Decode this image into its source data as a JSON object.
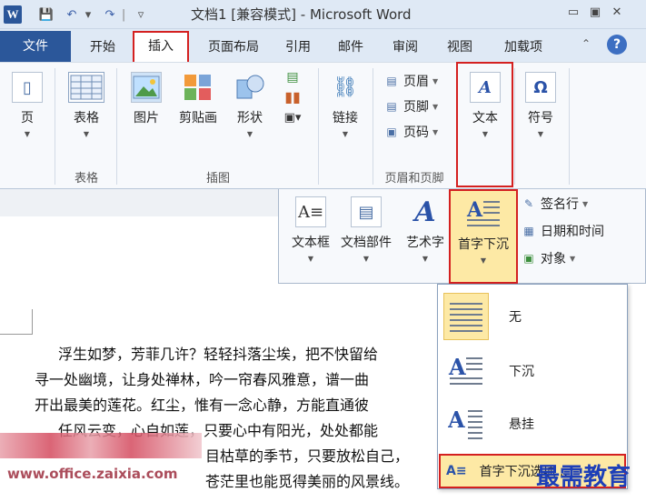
{
  "window": {
    "title": "文档1 [兼容模式] - Microsoft Word",
    "logo_letter": "W",
    "controls": [
      "▭",
      "▣",
      "✕"
    ]
  },
  "quick_access": {
    "save_icon": "💾",
    "undo_icon": "↶",
    "redo_icon": "↷",
    "dropdown": "▾",
    "separator": "|",
    "customize": "▿"
  },
  "tabs": {
    "file": "文件",
    "home": "开始",
    "insert": "插入",
    "layout": "页面布局",
    "references": "引用",
    "mailings": "邮件",
    "review": "审阅",
    "view": "视图",
    "addins": "加载项",
    "help": "?"
  },
  "ribbon": {
    "pages": {
      "label": "页",
      "icon": "▯"
    },
    "table": {
      "label": "表格",
      "group": "表格"
    },
    "illustrations": {
      "picture": "图片",
      "clipart": "剪贴画",
      "shapes": "形状",
      "group": "插图"
    },
    "links": {
      "label": "链接"
    },
    "header_footer": {
      "header": "页眉",
      "footer": "页脚",
      "page_number": "页码",
      "group": "页眉和页脚"
    },
    "text": {
      "label": "文本",
      "icon": "A"
    },
    "symbols": {
      "label": "符号",
      "icon": "Ω"
    }
  },
  "text_panel": {
    "textbox": "文本框",
    "quickparts": "文档部件",
    "wordart": "艺术字",
    "dropcap": "首字下沉",
    "signature": "签名行",
    "datetime": "日期和时间",
    "object": "对象"
  },
  "dropcap_menu": {
    "none": "无",
    "dropped": "下沉",
    "margin": "悬挂",
    "options": "首字下沉选项..."
  },
  "document": {
    "line1": "浮生如梦，芳菲几许？轻轻抖落尘埃，把不快留给",
    "line2": "寻一处幽境，让身处禅林，吟一帘春风雅意，谱一曲",
    "line3": "开出最美的莲花。红尘，惟有一念心静，方能直通彼",
    "line4": "任风云变，心自如莲，只要心中有阳光，处处都能",
    "line5": "目枯草的季节，只要放松自己，",
    "line6": "苍茫里也能觅得美丽的风景线。"
  },
  "watermarks": {
    "site": "www.office.zaixia.com",
    "brand": "最需教育"
  }
}
